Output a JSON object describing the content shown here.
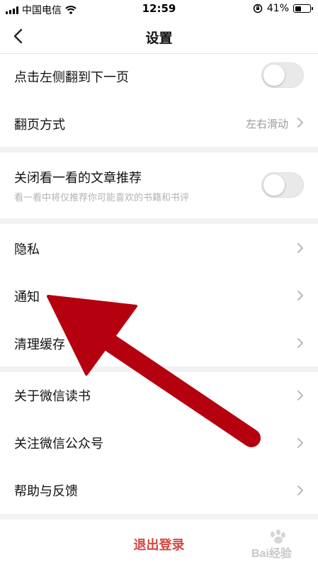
{
  "status_bar": {
    "carrier": "中国电信",
    "time": "12:59",
    "battery": "41%"
  },
  "nav": {
    "title": "设置"
  },
  "sections": {
    "tap_left": {
      "label": "点击左侧翻到下一页",
      "enabled": false
    },
    "page_turn": {
      "label": "翻页方式",
      "value": "左右滑动"
    },
    "recommend": {
      "label": "关闭看一看的文章推荐",
      "subtitle": "看一看中将仅推荐你可能喜欢的书籍和书评",
      "enabled": false
    },
    "privacy": {
      "label": "隐私"
    },
    "notify": {
      "label": "通知"
    },
    "clear_cache": {
      "label": "清理缓存"
    },
    "about": {
      "label": "关于微信读书"
    },
    "follow": {
      "label": "关注微信公众号"
    },
    "help": {
      "label": "帮助与反馈"
    }
  },
  "logout": {
    "label": "退出登录"
  },
  "watermark": {
    "text": "Bai经验"
  },
  "colors": {
    "accent_red": "#d9463e",
    "annotation_arrow": "#b5000f",
    "section_gap": "#f2f2f2",
    "toggle_off": "#e9e9ea"
  }
}
